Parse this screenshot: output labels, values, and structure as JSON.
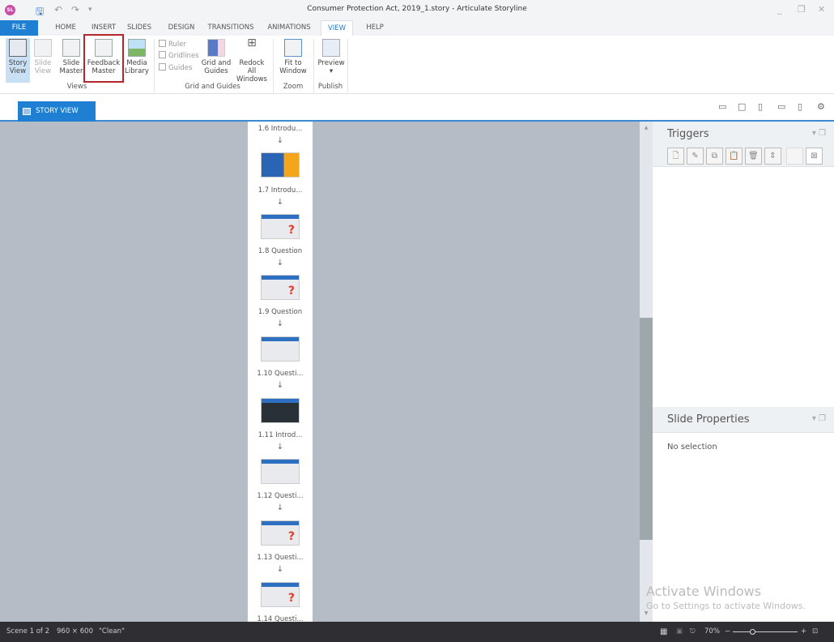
{
  "app": {
    "logo": "SL",
    "window_title": "Consumer Protection Act, 2019_1.story -  Articulate Storyline"
  },
  "quick_access": {
    "save_icon": "save-icon",
    "undo_icon": "undo-icon",
    "redo_icon": "redo-icon",
    "customize_icon": "customize-qat-icon"
  },
  "window_controls": {
    "minimize": "_",
    "restore": "❐",
    "close": "✕"
  },
  "ribbon_tabs": [
    {
      "label": "FILE"
    },
    {
      "label": "HOME"
    },
    {
      "label": "INSERT"
    },
    {
      "label": "SLIDES"
    },
    {
      "label": "DESIGN"
    },
    {
      "label": "TRANSITIONS"
    },
    {
      "label": "ANIMATIONS"
    },
    {
      "label": "VIEW",
      "active": true
    },
    {
      "label": "HELP"
    }
  ],
  "ribbon": {
    "views": {
      "label": "Views",
      "story_view": "Story View",
      "slide_view": "Slide View",
      "slide_master": "Slide Master",
      "feedback_master": "Feedback Master",
      "media_library": "Media Library"
    },
    "grid": {
      "label": "Grid and Guides",
      "ruler": "Ruler",
      "gridlines": "Gridlines",
      "guides": "Guides",
      "grid_and_guides": "Grid and Guides",
      "redock": "Redock All Windows"
    },
    "zoom": {
      "label": "Zoom",
      "fit": "Fit to Window"
    },
    "publish": {
      "label": "Publish",
      "preview": "Preview"
    }
  },
  "view_tab": {
    "label": "STORY VIEW"
  },
  "slides": [
    {
      "label": "1.6 Introdu..."
    },
    {
      "label": "1.7 Introdu..."
    },
    {
      "label": "1.8 Question"
    },
    {
      "label": "1.9 Question"
    },
    {
      "label": "1.10 Questi..."
    },
    {
      "label": "1.11 Introd..."
    },
    {
      "label": "1.12 Questi..."
    },
    {
      "label": "1.13 Questi..."
    },
    {
      "label": "1.14 Questi..."
    }
  ],
  "panels": {
    "triggers": {
      "title": "Triggers"
    },
    "slide_properties": {
      "title": "Slide Properties",
      "empty": "No selection"
    }
  },
  "watermark": {
    "line1": "Activate Windows",
    "line2": "Go to Settings to activate Windows."
  },
  "status_bar": {
    "scene": "Scene 1 of 2",
    "size": "960 × 600",
    "theme": "\"Clean\"",
    "zoom": "70%",
    "zoom_minus": "−",
    "zoom_plus": "+"
  }
}
